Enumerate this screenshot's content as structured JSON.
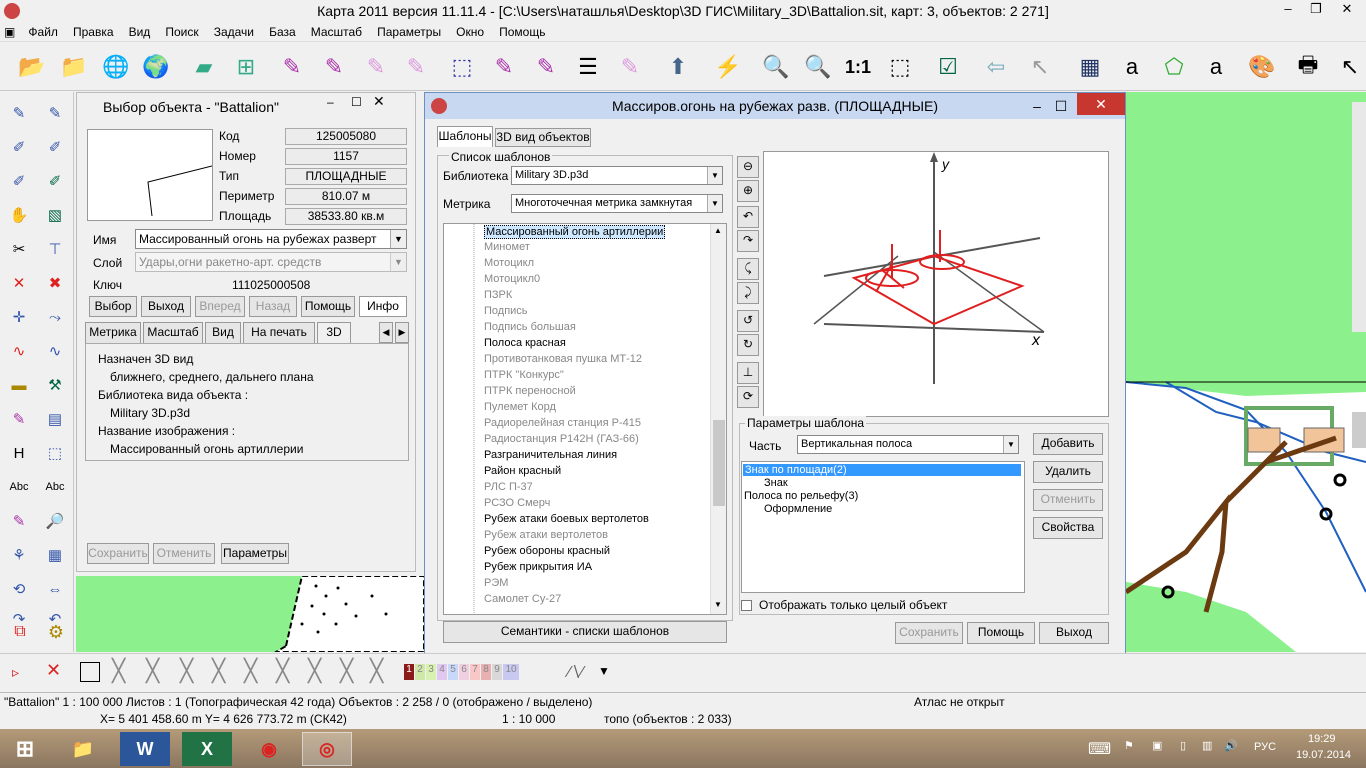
{
  "window": {
    "title": "Карта 2011 версия 11.11.4 - [C:\\Users\\наташлья\\Desktop\\3D ГИС\\Military_3D\\Battalion.sit, карт: 3, объектов: 2 271]",
    "minimize": "–",
    "restore": "❐",
    "close": "✕"
  },
  "menu": [
    "Файл",
    "Правка",
    "Вид",
    "Поиск",
    "Задачи",
    "База",
    "Масштаб",
    "Параметры",
    "Окно",
    "Помощь"
  ],
  "toolbar": {
    "scale_label": "1:1"
  },
  "object_panel": {
    "title": "Выбор объекта - \"Battalion\"",
    "fields": [
      {
        "label": "Код",
        "value": "125005080"
      },
      {
        "label": "Номер",
        "value": "1157"
      },
      {
        "label": "Тип",
        "value": "ПЛОЩАДНЫЕ"
      },
      {
        "label": "Периметр",
        "value": "810.07",
        "unit": "м"
      },
      {
        "label": "Площадь",
        "value": "38533.80",
        "unit": "кв.м"
      }
    ],
    "name_label": "Имя",
    "name_value": "Массированный огонь на рубежах разверт",
    "layer_label": "Слой",
    "layer_value": "Удары,огни ракетно-арт. средств",
    "key_label": "Ключ",
    "key_value": "111025000508",
    "buttons": [
      "Выбор",
      "Выход",
      "Вперед",
      "Назад",
      "Помощь",
      "Инфо"
    ],
    "tabs": [
      "Метрика",
      "Масштаб",
      "Вид",
      "На печать",
      "3D"
    ],
    "info_lines": [
      "Назначен 3D вид",
      "ближнего, среднего, дальнего плана",
      "Библиотека вида объекта :",
      "Military 3D.p3d",
      "Название изображения :",
      "Массированный огонь артиллерии"
    ],
    "bottom_buttons": [
      "Сохранить",
      "Отменить",
      "Параметры"
    ]
  },
  "dialog": {
    "title": "Массиров.огонь на рубежах разв. (ПЛОЩАДНЫЕ)",
    "tabs": [
      "Шаблоны",
      "3D вид объектов"
    ],
    "group_label": "Список шаблонов",
    "library_label": "Библиотека",
    "library_value": "Military 3D.p3d",
    "metric_label": "Метрика",
    "metric_value": "Многоточечная метрика замкнутая",
    "items": [
      {
        "t": "Массированный огонь артиллерии",
        "s": "sel"
      },
      {
        "t": "Миномет",
        "s": "g"
      },
      {
        "t": "Мотоцикл",
        "s": "g"
      },
      {
        "t": "Мотоцикл0",
        "s": "g"
      },
      {
        "t": "ПЗРК",
        "s": "g"
      },
      {
        "t": "Подпись",
        "s": "g"
      },
      {
        "t": "Подпись большая",
        "s": "g"
      },
      {
        "t": "Полоса красная",
        "s": "b"
      },
      {
        "t": "Противотанковая пушка МТ-12",
        "s": "g"
      },
      {
        "t": "ПТРК \"Конкурс\"",
        "s": "g"
      },
      {
        "t": "ПТРК переносной",
        "s": "g"
      },
      {
        "t": "Пулемет Корд",
        "s": "g"
      },
      {
        "t": "Радиорелейная станция  Р-415",
        "s": "g"
      },
      {
        "t": "Радиостанция Р142Н (ГАЗ-66)",
        "s": "g"
      },
      {
        "t": "Разграничительная линия",
        "s": "b"
      },
      {
        "t": "Район красный",
        "s": "b"
      },
      {
        "t": "РЛС П-37",
        "s": "g"
      },
      {
        "t": "РСЗО Смерч",
        "s": "g"
      },
      {
        "t": "Рубеж атаки боевых вертолетов",
        "s": "b"
      },
      {
        "t": "Рубеж атаки вертолетов",
        "s": "g"
      },
      {
        "t": "Рубеж обороны красный",
        "s": "b"
      },
      {
        "t": "Рубеж прикрытия ИА",
        "s": "b"
      },
      {
        "t": "РЭМ",
        "s": "g"
      },
      {
        "t": "Самолет Су-27",
        "s": "g"
      }
    ],
    "semantics_button": "Семантики - списки шаблонов",
    "axis_x": "x",
    "axis_y": "y",
    "params_label": "Параметры шаблона",
    "part_label": "Часть",
    "part_value": "Вертикальная полоса",
    "tree": [
      {
        "t": "Знак по площади(2)",
        "indent": 0,
        "sel": true
      },
      {
        "t": "Знак",
        "indent": 1,
        "sel": false
      },
      {
        "t": "Полоса по рельефу(3)",
        "indent": 0,
        "sel": false
      },
      {
        "t": "Оформление",
        "indent": 1,
        "sel": false
      }
    ],
    "side_buttons": [
      "Добавить",
      "Удалить",
      "Отменить",
      "Свойства"
    ],
    "checkbox_label": "Отображать только целый объект",
    "bottom_buttons": [
      "Сохранить",
      "Помощь",
      "Выход"
    ]
  },
  "palette": [
    "1",
    "2",
    "3",
    "4",
    "5",
    "6",
    "7",
    "8",
    "9",
    "10"
  ],
  "status": {
    "left": "\"Battalion\"  1 : 100 000   Листов : 1   (Топографическая 42 года)  Объектов : 2 258 / 0  (отображено / выделено)",
    "right": "Атлас не открыт",
    "coords": "X= 5 401 458.60 m      Y= 4 626 773.72 m  (СК42)",
    "scale": "1 : 10 000",
    "topo": "топо   (объектов : 2 033)"
  },
  "taskbar": {
    "lang": "РУС",
    "time": "19:29",
    "date": "19.07.2014"
  },
  "colors": {
    "accent": "#3399ff",
    "map_green": "#8cf08c",
    "red": "#e02020"
  }
}
